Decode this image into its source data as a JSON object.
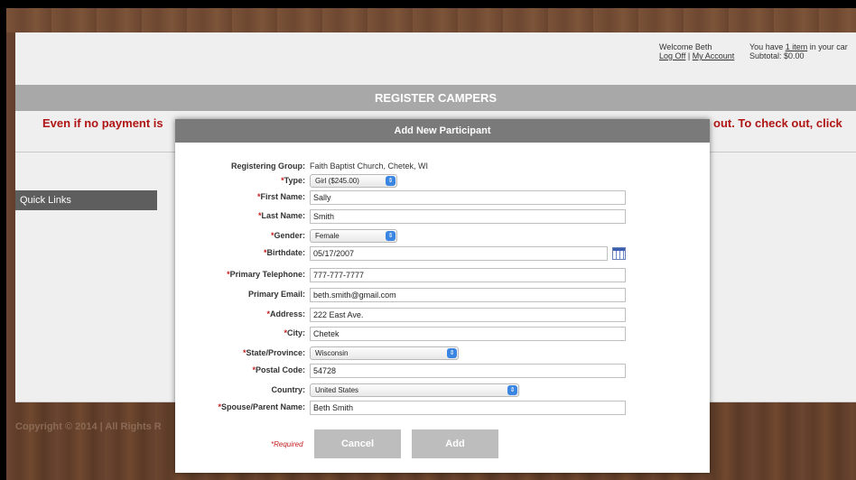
{
  "header": {
    "welcome_text": "Welcome Beth",
    "logoff_link": "Log Off",
    "link_sep": "|",
    "myaccount_link": "My Account",
    "cart_prefix": "You have",
    "cart_item_link": "1 item",
    "cart_suffix": "in your car",
    "subtotal": "Subtotal: $0.00"
  },
  "page": {
    "section_title": "REGISTER CAMPERS",
    "notice_left": "Even if no payment is",
    "notice_right": "out. To check out, click",
    "quick_links": "Quick Links",
    "copyright": "Copyright © 2014 | All Rights R"
  },
  "modal": {
    "title": "Add New Participant",
    "registering_group_label": "Registering Group:",
    "registering_group_value": "Faith Baptist Church, Chetek, WI",
    "fields": {
      "type": {
        "label": "Type:",
        "value": "Girl ($245.00)"
      },
      "first_name": {
        "label": "First Name:",
        "value": "Sally"
      },
      "last_name": {
        "label": "Last Name:",
        "value": "Smith"
      },
      "gender": {
        "label": "Gender:",
        "value": "Female"
      },
      "birthdate": {
        "label": "Birthdate:",
        "value": "05/17/2007"
      },
      "primary_telephone": {
        "label": "Primary Telephone:",
        "value": "777-777-7777"
      },
      "primary_email": {
        "label": "Primary Email:",
        "value": "beth.smith@gmail.com"
      },
      "address": {
        "label": "Address:",
        "value": "222 East Ave."
      },
      "city": {
        "label": "City:",
        "value": "Chetek"
      },
      "state": {
        "label": "State/Province:",
        "value": "Wisconsin"
      },
      "postal_code": {
        "label": "Postal Code:",
        "value": "54728"
      },
      "country": {
        "label": "Country:",
        "value": "United States"
      },
      "spouse_parent": {
        "label": "Spouse/Parent Name:",
        "value": "Beth Smith"
      }
    },
    "required_marker": "*",
    "required_note": "*Required",
    "cancel_label": "Cancel",
    "add_label": "Add"
  }
}
